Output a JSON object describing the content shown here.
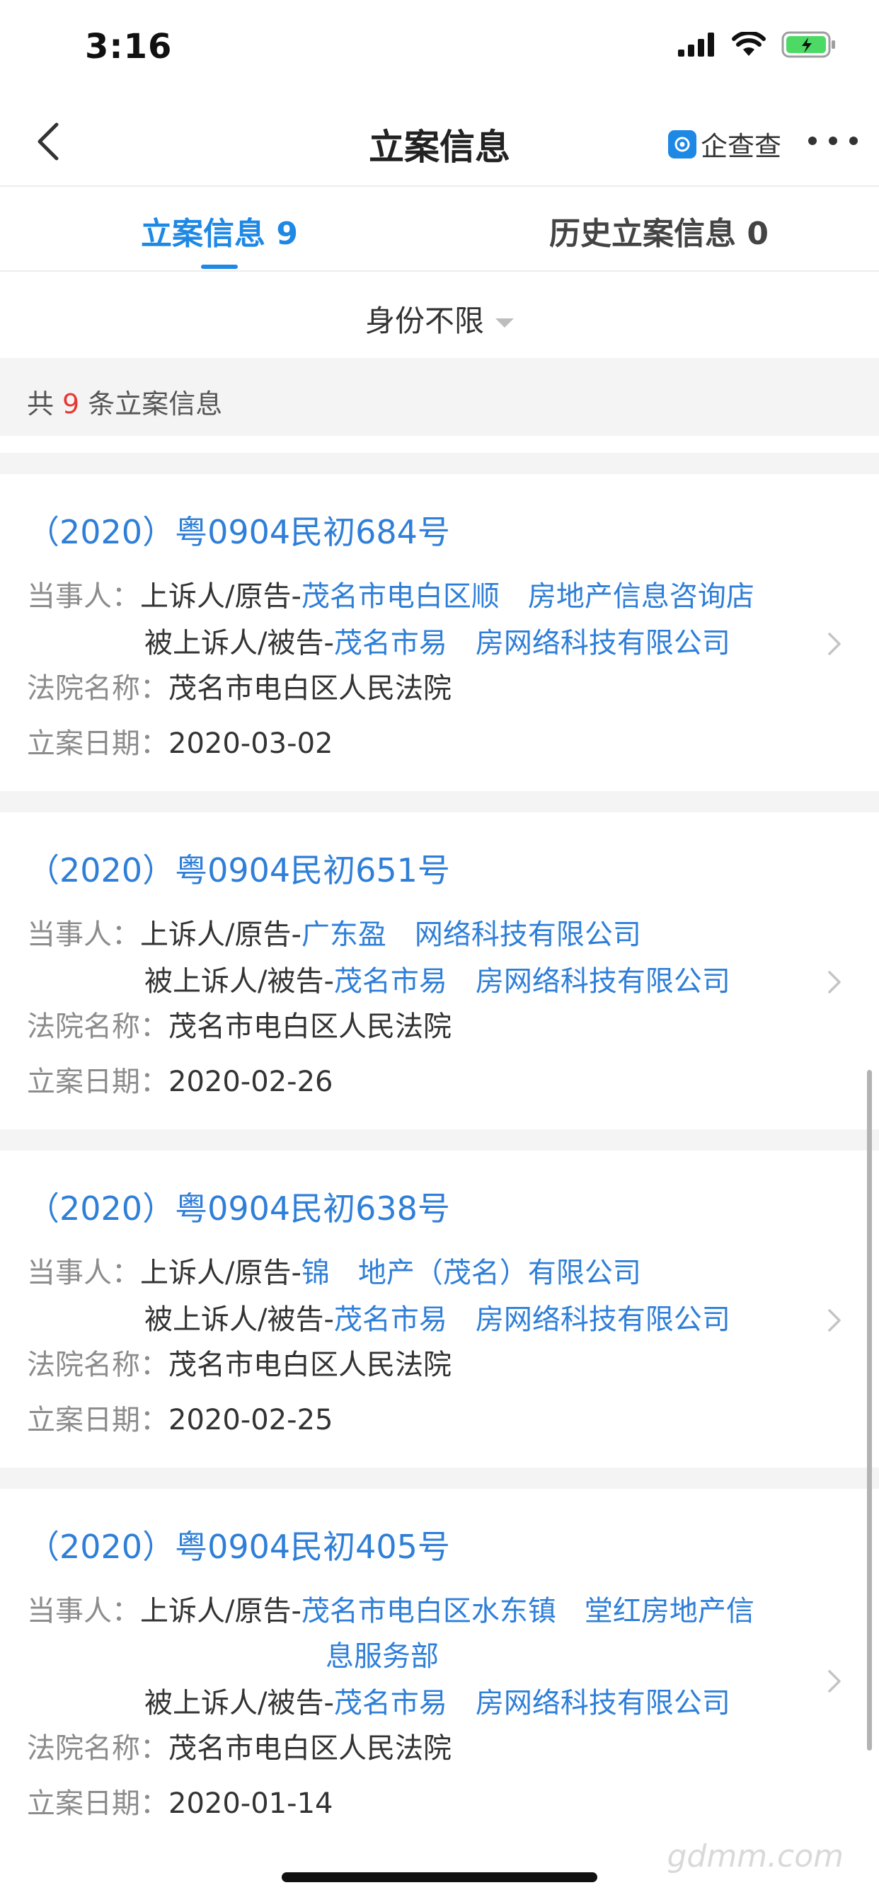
{
  "status_bar": {
    "time": "3:16"
  },
  "nav": {
    "title": "立案信息",
    "brand": "企查查"
  },
  "tabs": [
    {
      "label": "立案信息 9",
      "active": true
    },
    {
      "label": "历史立案信息 0",
      "active": false
    }
  ],
  "filter": {
    "label": "身份不限"
  },
  "summary": {
    "prefix": "共",
    "count": "9",
    "suffix": "条立案信息"
  },
  "labels": {
    "parties": "当事人：",
    "court": "法院名称：",
    "date": "立案日期："
  },
  "cases": [
    {
      "case_no": "（2020）粤0904民初684号",
      "plaintiff_role": "上诉人/原告-",
      "plaintiff": "茂名市电白区顺　房地产信息咨询店",
      "defendant_role": "被上诉人/被告-",
      "defendant": "茂名市易　房网络科技有限公司",
      "court": "茂名市电白区人民法院",
      "date": "2020-03-02"
    },
    {
      "case_no": "（2020）粤0904民初651号",
      "plaintiff_role": "上诉人/原告-",
      "plaintiff": "广东盈　网络科技有限公司",
      "defendant_role": "被上诉人/被告-",
      "defendant": "茂名市易　房网络科技有限公司",
      "court": "茂名市电白区人民法院",
      "date": "2020-02-26"
    },
    {
      "case_no": "（2020）粤0904民初638号",
      "plaintiff_role": "上诉人/原告-",
      "plaintiff": "锦　地产（茂名）有限公司",
      "defendant_role": "被上诉人/被告-",
      "defendant": "茂名市易　房网络科技有限公司",
      "court": "茂名市电白区人民法院",
      "date": "2020-02-25"
    },
    {
      "case_no": "（2020）粤0904民初405号",
      "plaintiff_role": "上诉人/原告-",
      "plaintiff": "茂名市电白区水东镇　堂红房地产信",
      "plaintiff_line2": "息服务部",
      "defendant_role": "被上诉人/被告-",
      "defendant": "茂名市易　房网络科技有限公司",
      "court": "茂名市电白区人民法院",
      "date": "2020-01-14"
    }
  ],
  "watermark": "gdmm.com"
}
